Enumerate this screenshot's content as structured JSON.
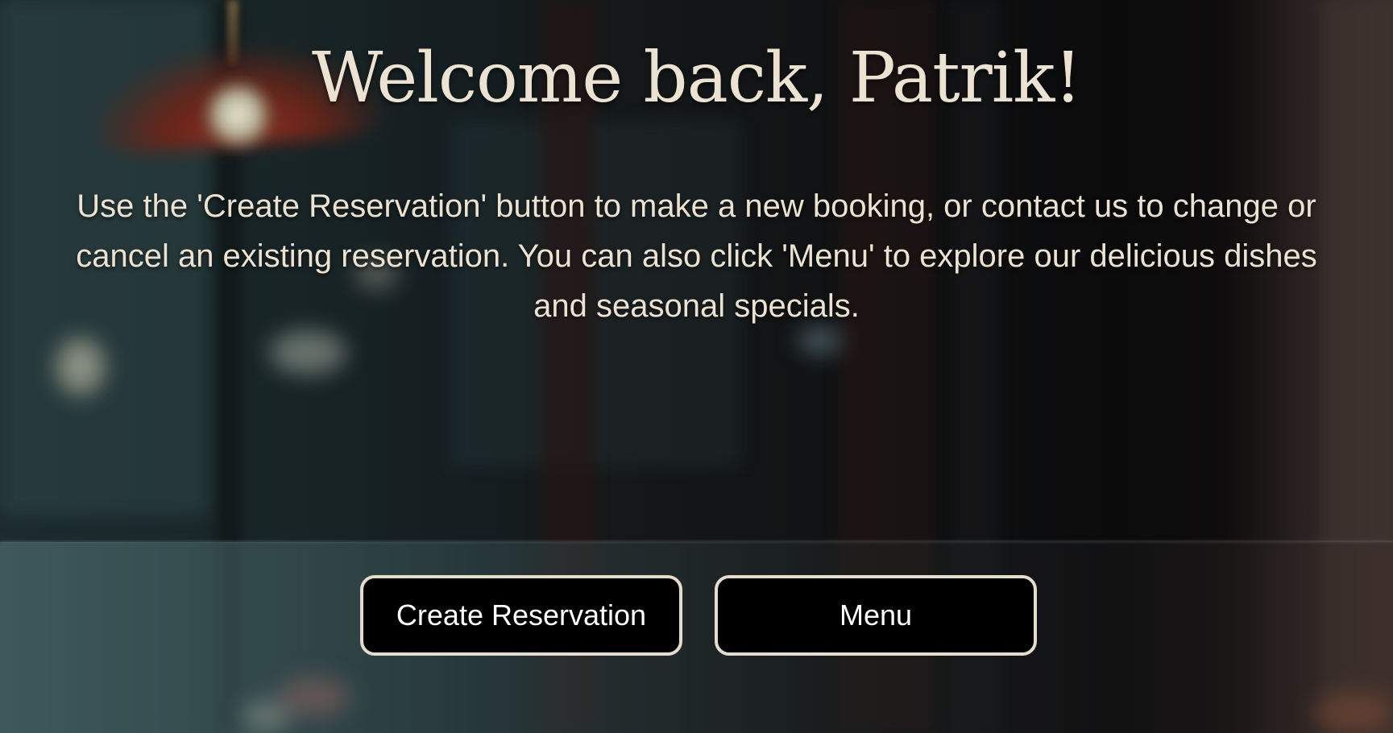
{
  "page": {
    "background_description_colors": {
      "text": "#ebe2d2",
      "button_bg": "#000000",
      "button_border": "#e5dccb",
      "button_text": "#ffffff"
    }
  },
  "hero": {
    "title": "Welcome back, Patrik!",
    "text": "Use the 'Create Reservation' button to make a new booking, or contact us to change or cancel an existing reservation. You can also click 'Menu' to explore our delicious dishes and seasonal specials."
  },
  "actions": {
    "create_reservation_label": "Create Reservation",
    "menu_label": "Menu"
  }
}
